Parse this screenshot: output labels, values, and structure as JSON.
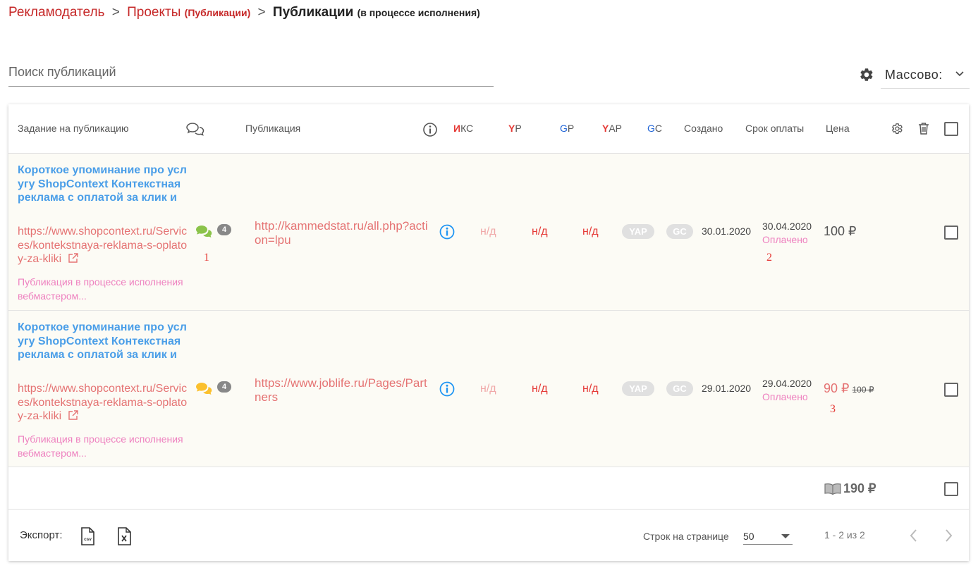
{
  "breadcrumb": {
    "advertiser": "Рекламодатель",
    "sep1": ">",
    "projects": "Проекты",
    "projects_sub": "(Публикации)",
    "sep2": ">",
    "current": "Публикации",
    "current_sub": "(в процессе исполнения)"
  },
  "search": {
    "placeholder": "Поиск публикаций"
  },
  "mass": {
    "label": "Массово:"
  },
  "table": {
    "headers": {
      "task": "Задание на публикацию",
      "publication": "Публикация",
      "iks_red": "И",
      "iks_rest": "КС",
      "yr_red": "Y",
      "yr_rest": "Р",
      "gr_blue": "G",
      "gr_rest": "Р",
      "yap_red": "Y",
      "yap_rest": "АР",
      "gc_blue": "G",
      "gc_rest": "C",
      "created": "Создано",
      "due": "Срок оплаты",
      "price": "Цена"
    },
    "rows": [
      {
        "title": "Короткое упоминание про услугу ShopContext Контекстная реклама с оплатой за клик и",
        "url": "https://www.shopcontext.ru/Services/kontekstnaya-reklama-s-oplatoy-za-kliki",
        "status": "Публикация в процессе исполнения вебмастером...",
        "comments": "4",
        "annotation_chat": "1",
        "pub_url": "http://kammedstat.ru/all.php?action=lpu",
        "iks": "н/д",
        "yr": "н/д",
        "gr": "н/д",
        "yap": "YAP",
        "gc": "GC",
        "created": "30.01.2020",
        "due": "30.04.2020",
        "paid": "Оплачено",
        "annotation_due": "2",
        "price": "100 ₽"
      },
      {
        "title": "Короткое упоминание про услугу ShopContext Контекстная реклама с оплатой за клик и",
        "url": "https://www.shopcontext.ru/Services/kontekstnaya-reklama-s-oplatoy-za-kliki",
        "status": "Публикация в процессе исполнения вебмастером...",
        "comments": "4",
        "pub_url": "https://www.joblife.ru/Pages/Partners",
        "iks": "н/д",
        "yr": "н/д",
        "gr": "н/д",
        "yap": "YAP",
        "gc": "GC",
        "created": "29.01.2020",
        "due": "29.04.2020",
        "paid": "Оплачено",
        "price": "90 ₽",
        "old_price": "100 ₽",
        "annotation_price": "3"
      }
    ],
    "total": "190 ₽"
  },
  "footer": {
    "export_label": "Экспорт:",
    "rows_label": "Строк на странице",
    "rows_value": "50",
    "range": "1 - 2 из 2"
  },
  "colors": {
    "breadcrumb_link": "#c62828",
    "title_link": "#4a9ee8",
    "url_link": "#e57373",
    "status_pink": "#ee82c0",
    "chat_green": "#8bc34a",
    "chat_yellow": "#fbc02d",
    "info_blue": "#2196f3",
    "row_bg": "#fcfbf5"
  },
  "icons": [
    "gear-icon",
    "chevron-down-icon",
    "comments-icon",
    "info-icon",
    "settings-icon",
    "trash-icon",
    "chat-bubble-icon",
    "external-link-icon",
    "book-icon",
    "csv-file-icon",
    "xls-file-icon",
    "chevron-left-icon",
    "chevron-right-icon"
  ]
}
